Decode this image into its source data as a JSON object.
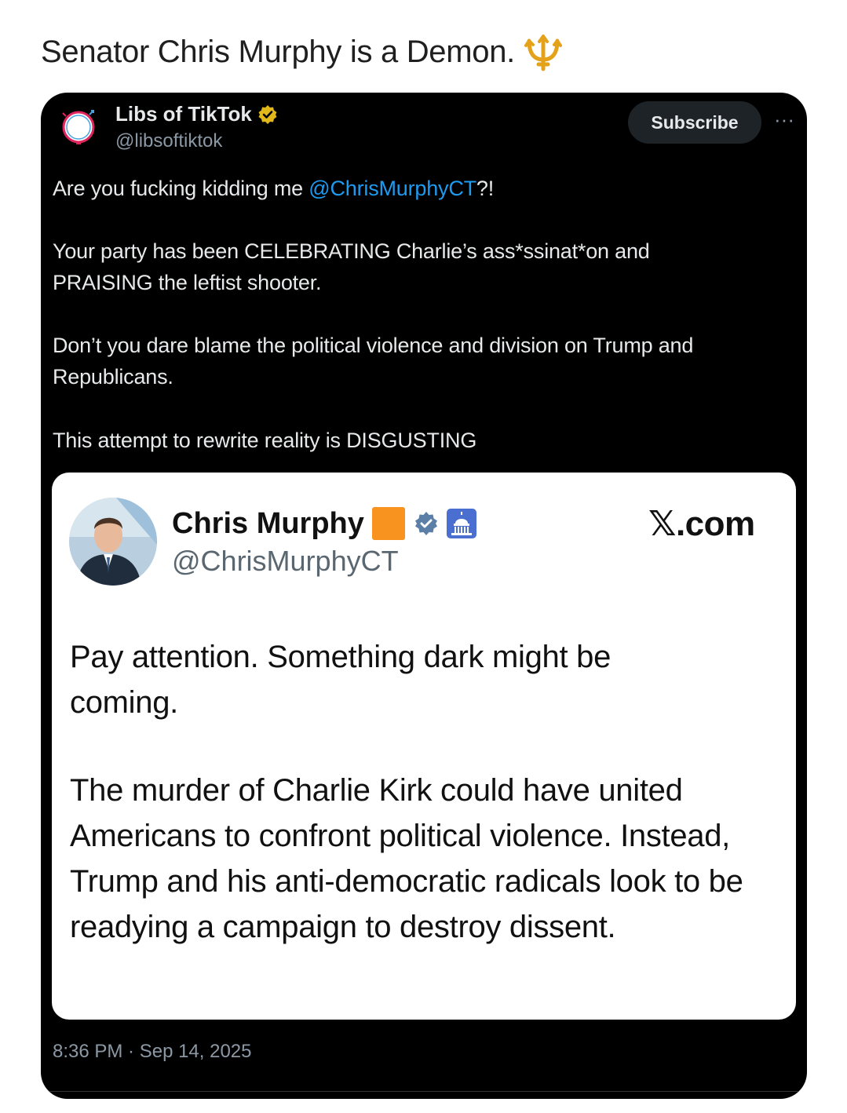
{
  "caption": {
    "text": "Senator Chris Murphy is a Demon.",
    "emoji_icon": "trident-icon"
  },
  "tweet": {
    "author": {
      "name": "Libs of TikTok",
      "handle": "@libsoftiktok",
      "verified": true,
      "avatar_text": "Libs of TikTok"
    },
    "subscribe_label": "Subscribe",
    "more_label": "···",
    "body": {
      "line1_prefix": "Are you fucking kidding me ",
      "line1_mention": "@ChrisMurphyCT",
      "line1_suffix": "?!",
      "para2": "Your party has been CELEBRATING Charlie’s ass*ssinat*on and PRAISING the leftist shooter.",
      "para3": "Don’t you dare blame the political violence and division on Trump and Republicans.",
      "para4": "This attempt to rewrite reality is DISGUSTING"
    },
    "timestamp": "8:36 PM · Sep 14, 2025"
  },
  "quoted": {
    "name": "Chris Murphy",
    "handle": "@ChrisMurphyCT",
    "brand": "𝕏.com",
    "badges": [
      "orange-square-icon",
      "verified-badge-icon",
      "capitol-icon"
    ],
    "para1": "Pay attention. Something dark might be coming.",
    "para2": "The murder of Charlie Kirk could have united Americans to confront political violence. Instead, Trump and his anti-democratic radicals look to be readying a campaign to destroy dissent."
  },
  "colors": {
    "card_bg": "#000000",
    "mention": "#1d9bf0",
    "verified_gold": "#e2b719",
    "orange_square": "#f7931e",
    "badge_blue": "#5b7fa6"
  }
}
